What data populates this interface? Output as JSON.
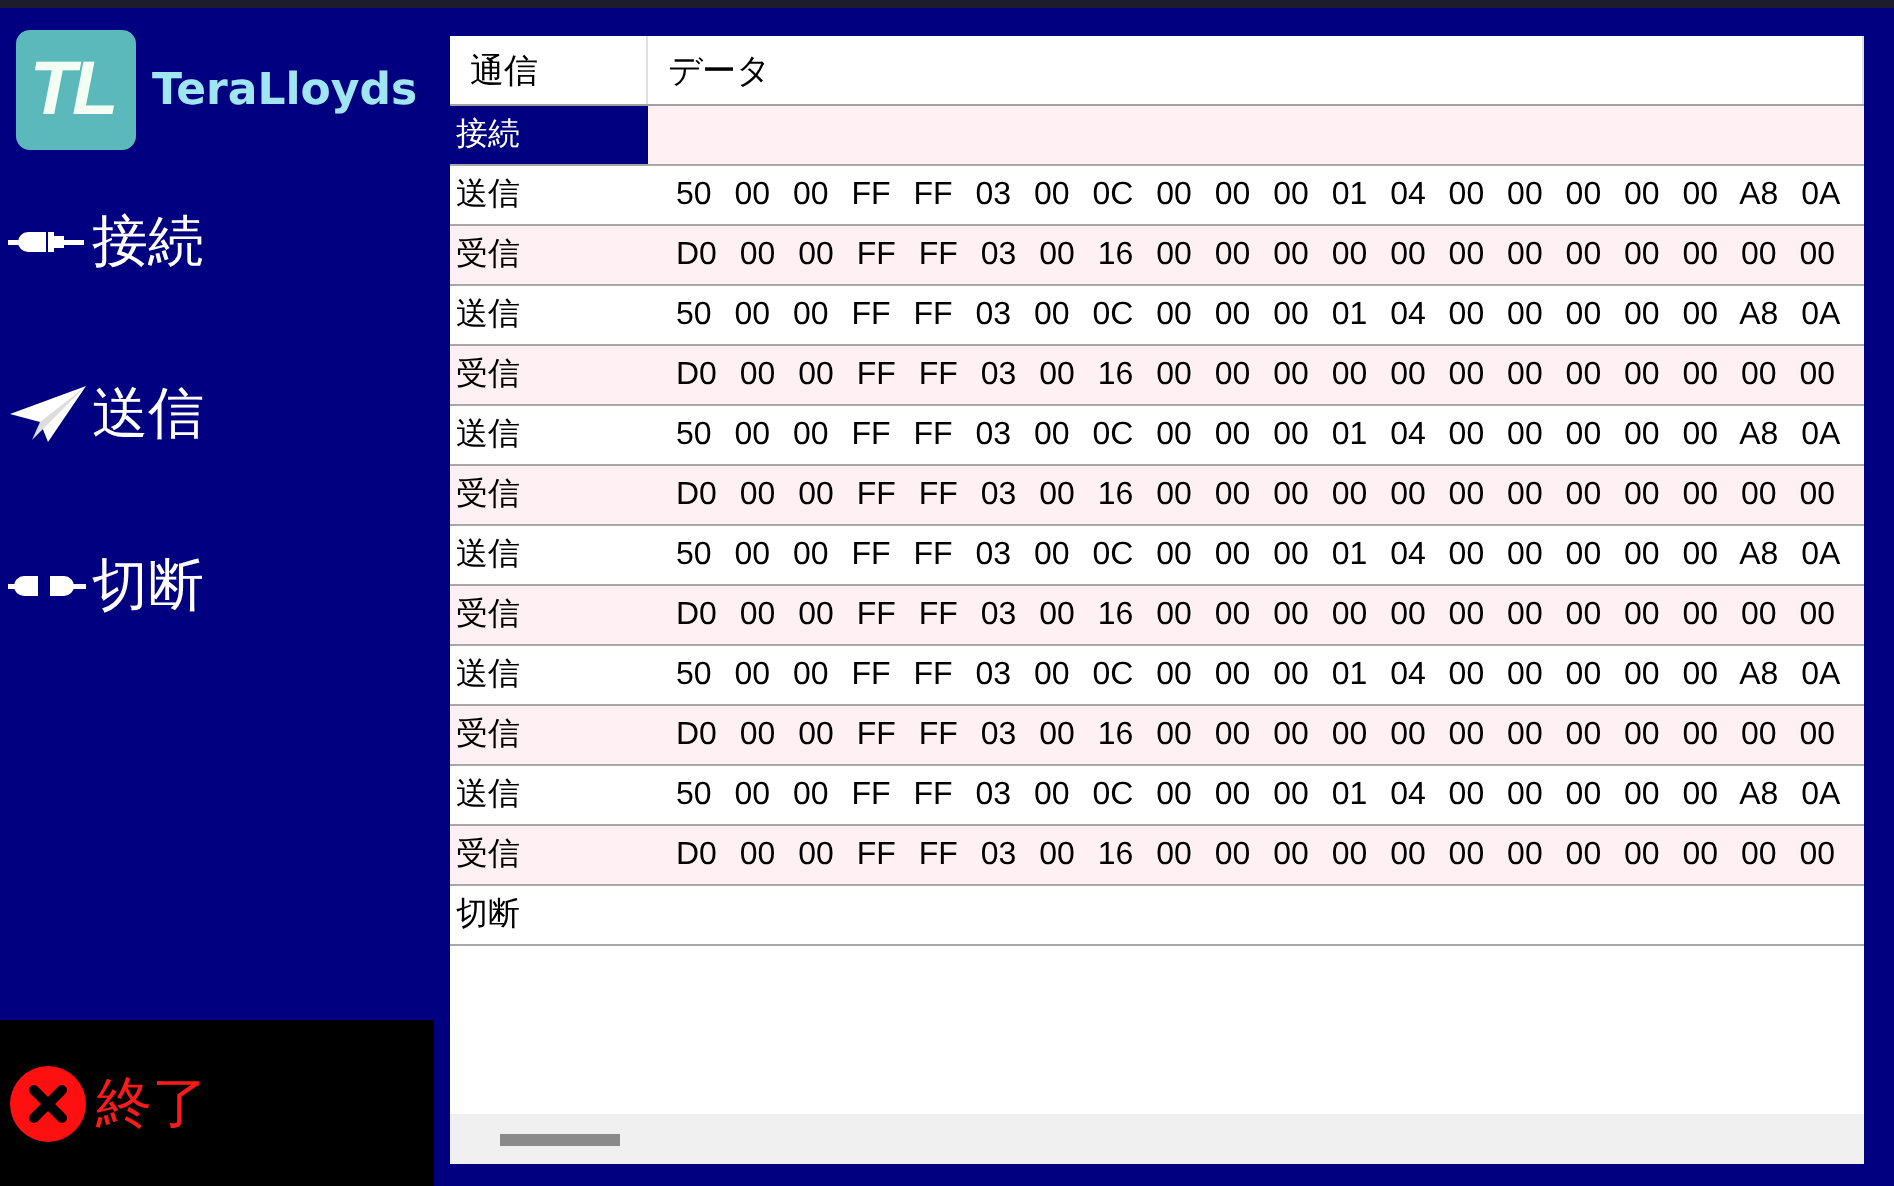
{
  "logo": {
    "mark": "TL",
    "name": "TeraLloyds"
  },
  "menu": [
    {
      "kind": "connect",
      "label": "接続"
    },
    {
      "kind": "send",
      "label": "送信"
    },
    {
      "kind": "disconnect",
      "label": "切断"
    }
  ],
  "exit_button": {
    "label": "終了"
  },
  "table": {
    "columns": [
      "通信",
      "データ"
    ],
    "rows": [
      {
        "type": "接続",
        "data": "",
        "selected": true
      },
      {
        "type": "送信",
        "data": "50 00 00 FF FF 03 00 0C 00 00 00 01 04 00 00 00 00 00 A8 0A",
        "selected": false
      },
      {
        "type": "受信",
        "data": "D0 00 00 FF FF 03 00 16 00 00 00 00 00 00 00 00 00 00 00 00",
        "selected": false
      },
      {
        "type": "送信",
        "data": "50 00 00 FF FF 03 00 0C 00 00 00 01 04 00 00 00 00 00 A8 0A",
        "selected": false
      },
      {
        "type": "受信",
        "data": "D0 00 00 FF FF 03 00 16 00 00 00 00 00 00 00 00 00 00 00 00",
        "selected": false
      },
      {
        "type": "送信",
        "data": "50 00 00 FF FF 03 00 0C 00 00 00 01 04 00 00 00 00 00 A8 0A",
        "selected": false
      },
      {
        "type": "受信",
        "data": "D0 00 00 FF FF 03 00 16 00 00 00 00 00 00 00 00 00 00 00 00",
        "selected": false
      },
      {
        "type": "送信",
        "data": "50 00 00 FF FF 03 00 0C 00 00 00 01 04 00 00 00 00 00 A8 0A",
        "selected": false
      },
      {
        "type": "受信",
        "data": "D0 00 00 FF FF 03 00 16 00 00 00 00 00 00 00 00 00 00 00 00",
        "selected": false
      },
      {
        "type": "送信",
        "data": "50 00 00 FF FF 03 00 0C 00 00 00 01 04 00 00 00 00 00 A8 0A",
        "selected": false
      },
      {
        "type": "受信",
        "data": "D0 00 00 FF FF 03 00 16 00 00 00 00 00 00 00 00 00 00 00 00",
        "selected": false
      },
      {
        "type": "送信",
        "data": "50 00 00 FF FF 03 00 0C 00 00 00 01 04 00 00 00 00 00 A8 0A",
        "selected": false
      },
      {
        "type": "受信",
        "data": "D0 00 00 FF FF 03 00 16 00 00 00 00 00 00 00 00 00 00 00 00",
        "selected": false
      },
      {
        "type": "切断",
        "data": "",
        "selected": false
      }
    ]
  }
}
